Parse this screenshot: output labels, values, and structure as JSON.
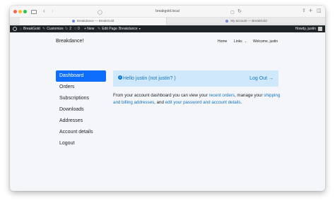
{
  "browser": {
    "url": "breakgold.local",
    "tabs": [
      "Breakdance — BreakGold",
      "My account — BreakGold"
    ]
  },
  "admin_bar": {
    "site_name": "BreakGold",
    "customize": "Customize",
    "updates": "2",
    "comments": "0",
    "new": "+ New",
    "edit_page": "Edit Page",
    "breakdance": "Breakdance",
    "howdy": "Howdy, justin"
  },
  "site": {
    "title": "Breakdance!",
    "nav": {
      "home": "Home",
      "links": "Links",
      "welcome": "Welcome, justin"
    }
  },
  "account_nav": [
    {
      "label": "Dashboard",
      "active": true
    },
    {
      "label": "Orders"
    },
    {
      "label": "Subscriptions"
    },
    {
      "label": "Downloads"
    },
    {
      "label": "Addresses"
    },
    {
      "label": "Account details"
    },
    {
      "label": "Logout"
    }
  ],
  "info_box": {
    "text": "Hello justin (not justin? )",
    "logout": "Log Out →"
  },
  "dashboard_text": {
    "part1": "From your account dashboard you can view your ",
    "link1": "recent orders",
    "part2": ", manage your ",
    "link2": "shipping and billing addresses",
    "part3": ", and ",
    "link3": "edit your password and account details",
    "part4": "."
  },
  "colors": {
    "accent": "#0d6efd",
    "link": "#1275c2",
    "info_bg": "#cfe8fb",
    "admin_bar": "#1d2327"
  }
}
